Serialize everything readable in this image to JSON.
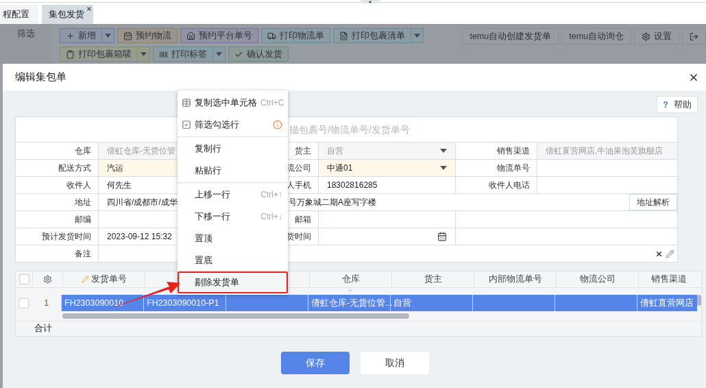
{
  "tabs": [
    {
      "label": "程配置",
      "selected": false,
      "closable": false
    },
    {
      "label": "集包发货",
      "selected": true,
      "closable": true
    }
  ],
  "sidebar": {
    "label": "筛选"
  },
  "toolbar": {
    "rows": [
      [
        {
          "label": "新增",
          "split": true
        },
        {
          "label": "预约物流",
          "split": false
        },
        {
          "label": "预约平台单号",
          "split": false
        },
        {
          "label": "打印物流单",
          "split": false
        },
        {
          "label": "打印包裹清单",
          "split": true
        }
      ],
      [
        {
          "label": "打印包裹箱唛",
          "split": true
        },
        {
          "label": "打印标签",
          "split": true
        },
        {
          "label": "确认发货",
          "split": false
        }
      ]
    ],
    "right": [
      {
        "kind": "text",
        "label": "temu自动创建发货单"
      },
      {
        "kind": "text",
        "label": "temu自动询仓"
      },
      {
        "kind": "text",
        "label": "设置"
      },
      {
        "kind": "icon"
      }
    ]
  },
  "dialog": {
    "title": "编辑集包单",
    "help_icon": "?",
    "help_button": "帮助",
    "scan_placeholder": "描包裹号/物流单号/发货单号",
    "form": [
      {
        "kind": "triple",
        "fields": [
          {
            "label": "仓库",
            "value": "倩虹仓库-无货位管",
            "disabled": true,
            "required": false
          },
          {
            "label": "货主",
            "value": "自营",
            "disabled": true,
            "required": false,
            "dropdown": true
          },
          {
            "label": "销售渠道",
            "value": "倩虹直营网店,牛油果泡芙旗舰店",
            "disabled": true,
            "required": false
          }
        ]
      },
      {
        "kind": "triple",
        "fields": [
          {
            "label": "配送方式",
            "value": "汽运",
            "disabled": false,
            "required": true
          },
          {
            "label": "流公司",
            "value": "中通01",
            "disabled": false,
            "required": true,
            "dropdown": true
          },
          {
            "label": "物流单号",
            "required": false
          }
        ]
      },
      {
        "kind": "triple",
        "fields": [
          {
            "label": "收件人",
            "value": "何先生",
            "disabled": false,
            "required": false
          },
          {
            "label": "人手机",
            "value": "18302816285",
            "disabled": false,
            "required": false
          },
          {
            "label": "收件人电话",
            "required": false
          }
        ]
      },
      {
        "kind": "address",
        "label": "地址",
        "value_left": "四川省/成都市/成华",
        "value_right": "号万象城二期A座写字楼",
        "button": "地址解析"
      },
      {
        "kind": "double",
        "fields": [
          {
            "label": "邮编",
            "required": false
          },
          {
            "label": "邮箱",
            "required": false
          }
        ]
      },
      {
        "kind": "double",
        "fields": [
          {
            "label": "预计发货时间",
            "value": "2023-09-12 15:32",
            "disabled": false,
            "required": false
          },
          {
            "label": "货时间",
            "required": false,
            "date": true
          }
        ]
      },
      {
        "kind": "remark",
        "label": "备注"
      }
    ],
    "grid": {
      "header_checked": false,
      "columns": [
        {
          "label": "发货单号",
          "editable": true
        },
        {},
        {},
        {
          "label": "仓库",
          "sortable": true
        },
        {
          "label": "货主"
        },
        {
          "label": "内部物流单号"
        },
        {
          "label": "物流公司"
        },
        {
          "label": "销售渠道"
        }
      ],
      "rows": [
        {
          "index": "1",
          "checked": false,
          "selected": true,
          "cells": [
            "FH2303090010",
            "FH2303090010-P1",
            "",
            "倩虹仓库-无货位管...",
            "自营",
            "",
            "",
            "倩虹直营网店"
          ]
        }
      ],
      "footer": "合计"
    },
    "buttons": [
      {
        "label": "保存",
        "kind": "primary"
      },
      {
        "label": "取消",
        "kind": "secondary"
      }
    ]
  },
  "context_menu": [
    {
      "kind": "item",
      "label": "复制选中单元格",
      "shortcut": "Ctrl+C",
      "highlighted": false
    },
    {
      "kind": "item",
      "label": "筛选勾选行",
      "info": true,
      "highlighted": false
    },
    {
      "kind": "divider"
    },
    {
      "kind": "item",
      "label": "复制行",
      "highlighted": false
    },
    {
      "kind": "item",
      "label": "粘贴行",
      "highlighted": false
    },
    {
      "kind": "divider"
    },
    {
      "kind": "item",
      "label": "上移一行",
      "shortcut": "Ctrl+↑",
      "highlighted": false
    },
    {
      "kind": "item",
      "label": "下移一行",
      "shortcut": "Ctrl+↓",
      "highlighted": false
    },
    {
      "kind": "item",
      "label": "置顶",
      "highlighted": false
    },
    {
      "kind": "item",
      "label": "置底",
      "highlighted": false
    },
    {
      "kind": "item",
      "label": "剔除发货单",
      "highlighted": true
    }
  ]
}
